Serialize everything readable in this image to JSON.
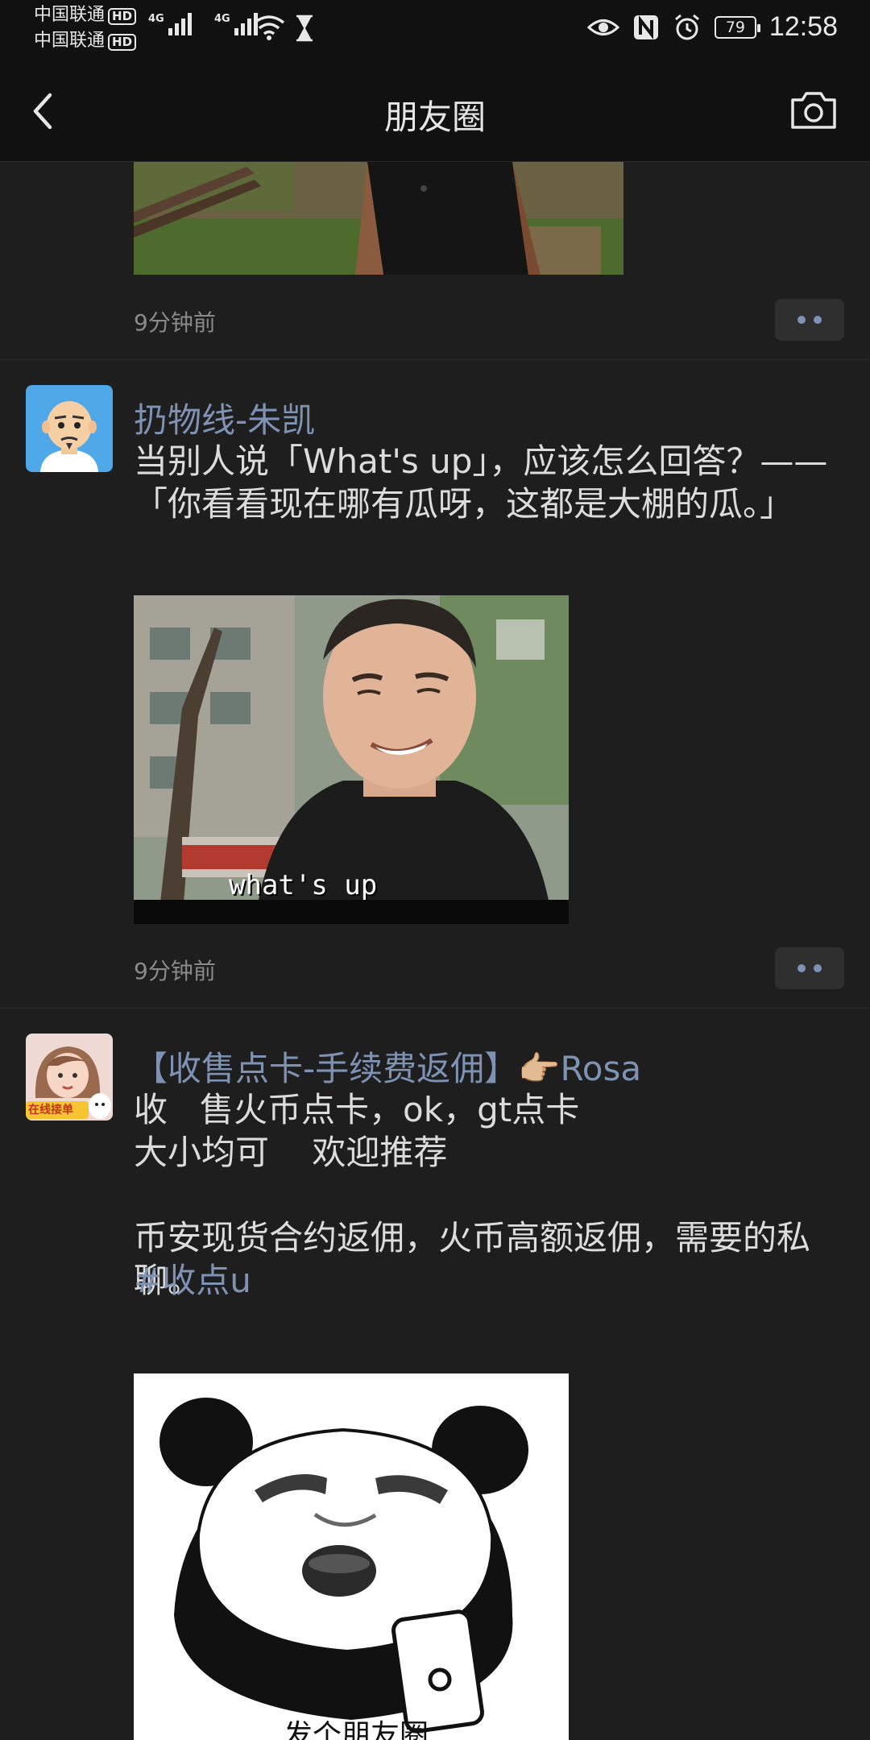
{
  "status_bar": {
    "carrier_1": "中国联通",
    "carrier_2": "中国联通",
    "hd_label": "HD",
    "network_1": "4G",
    "network_2": "4G",
    "battery": "79",
    "time": "12:58"
  },
  "nav": {
    "title": "朋友圈",
    "back_icon": "chevron-left-icon",
    "camera_icon": "camera-icon"
  },
  "posts": [
    {
      "time": "9分钟前"
    },
    {
      "author": "扔物线-朱凯",
      "text": "当别人说「What's up」，应该怎么回答？——「你看看现在哪有瓜呀，这都是大棚的瓜。」",
      "image_caption": "what's up",
      "time": "9分钟前"
    },
    {
      "author": "【收售点卡-手续费返佣】👉🏼Rosa",
      "text": "收   售火币点卡，ok，gt点卡\n大小均可    欢迎推荐\n\n币安现货合约返佣，火币高额返佣，需要的私聊。",
      "hashtag": "#收点u",
      "avatar_badge": "在线接单",
      "image_caption": "发个朋友圈"
    }
  ],
  "colors": {
    "background": "#1e1e1e",
    "bar": "#111111",
    "link": "#7e93b4",
    "text": "#dcdcdc",
    "muted": "#8a8a8a"
  }
}
